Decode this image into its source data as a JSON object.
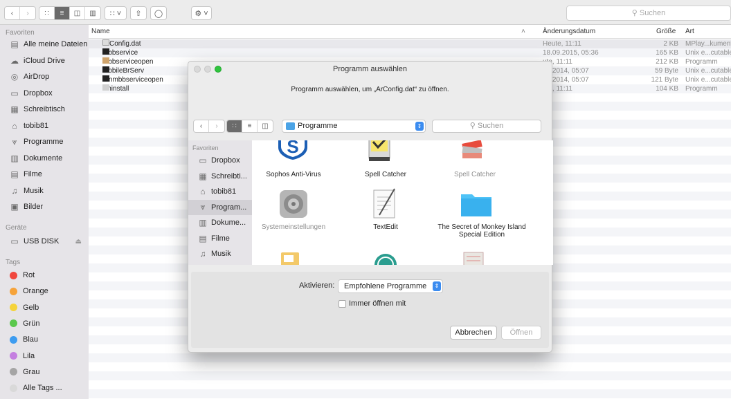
{
  "toolbar": {
    "search_placeholder": "Suchen",
    "icons": [
      "back-icon",
      "forward-icon",
      "icon-view-icon",
      "list-view-icon",
      "column-view-icon",
      "coverflow-view-icon",
      "arrange-icon",
      "share-icon",
      "tag-icon",
      "gear-icon"
    ]
  },
  "sidebar": {
    "favorites_header": "Favoriten",
    "favorites": [
      {
        "label": "Alle meine Dateien",
        "icon": "all-files-icon"
      },
      {
        "label": "iCloud Drive",
        "icon": "cloud-icon"
      },
      {
        "label": "AirDrop",
        "icon": "airdrop-icon"
      },
      {
        "label": "Dropbox",
        "icon": "folder-icon"
      },
      {
        "label": "Schreibtisch",
        "icon": "desktop-icon"
      },
      {
        "label": "tobib81",
        "icon": "home-icon"
      },
      {
        "label": "Programme",
        "icon": "applications-icon"
      },
      {
        "label": "Dokumente",
        "icon": "documents-icon"
      },
      {
        "label": "Filme",
        "icon": "movies-icon"
      },
      {
        "label": "Musik",
        "icon": "music-icon"
      },
      {
        "label": "Bilder",
        "icon": "pictures-icon"
      }
    ],
    "devices_header": "Geräte",
    "devices": [
      {
        "label": "USB DISK",
        "icon": "disk-icon"
      }
    ],
    "tags_header": "Tags",
    "tags": [
      {
        "label": "Rot",
        "color": "#f0473e"
      },
      {
        "label": "Orange",
        "color": "#f6a33a"
      },
      {
        "label": "Gelb",
        "color": "#f5d33a"
      },
      {
        "label": "Grün",
        "color": "#5bc84d"
      },
      {
        "label": "Blau",
        "color": "#3d9cf0"
      },
      {
        "label": "Lila",
        "color": "#c47fe0"
      },
      {
        "label": "Grau",
        "color": "#a5a5a5"
      },
      {
        "label": "Alle Tags ...",
        "color": "#d9d9d9"
      }
    ]
  },
  "list": {
    "columns": {
      "name": "Name",
      "date": "Änderungsdatum",
      "size": "Größe",
      "kind": "Art"
    },
    "rows": [
      {
        "name": "ArConfig.dat",
        "date": "Heute, 11:11",
        "size": "2 KB",
        "kind": "MPlay...kument"
      },
      {
        "name": "mbbservice",
        "date": "18.09.2015, 05:36",
        "size": "165 KB",
        "kind": "Unix e...cutable"
      },
      {
        "name": "mbbserviceopen",
        "date": "ute, 11:11",
        "size": "212 KB",
        "kind": "Programm"
      },
      {
        "name": "MobileBrServ",
        "date": "08.2014, 05:07",
        "size": "59 Byte",
        "kind": "Unix e...cutable"
      },
      {
        "name": "runmbbserviceopen",
        "date": "08.2014, 05:07",
        "size": "121 Byte",
        "kind": "Unix e...cutable"
      },
      {
        "name": "Uninstall",
        "date": "ute, 11:11",
        "size": "104 KB",
        "kind": "Programm"
      }
    ]
  },
  "dialog": {
    "title": "Programm auswählen",
    "message": "Programm auswählen, um „ArConfig.dat“ zu öffnen.",
    "location": "Programme",
    "search_placeholder": "Suchen",
    "sidebar_header": "Favoriten",
    "sidebar": [
      {
        "label": "Dropbox",
        "icon": "folder-icon"
      },
      {
        "label": "Schreibti...",
        "icon": "desktop-icon"
      },
      {
        "label": "tobib81",
        "icon": "home-icon"
      },
      {
        "label": "Program...",
        "icon": "applications-icon",
        "selected": true
      },
      {
        "label": "Dokume...",
        "icon": "documents-icon"
      },
      {
        "label": "Filme",
        "icon": "movies-icon"
      },
      {
        "label": "Musik",
        "icon": "music-icon"
      },
      {
        "label": "Bilder",
        "icon": "pictures-icon"
      }
    ],
    "apps": [
      {
        "label": "Sophos Anti-Virus",
        "enabled": true
      },
      {
        "label": "Spell Catcher",
        "enabled": true
      },
      {
        "label": "Spell Catcher",
        "enabled": false
      },
      {
        "label": "Systemeinstellungen",
        "enabled": false
      },
      {
        "label": "TextEdit",
        "enabled": true
      },
      {
        "label": "The Secret of Monkey Island Special Edition",
        "enabled": true
      }
    ],
    "activate_label": "Aktivieren:",
    "activate_value": "Empfohlene Programme",
    "always_open_label": "Immer öffnen mit",
    "cancel_label": "Abbrechen",
    "open_label": "Öffnen"
  }
}
